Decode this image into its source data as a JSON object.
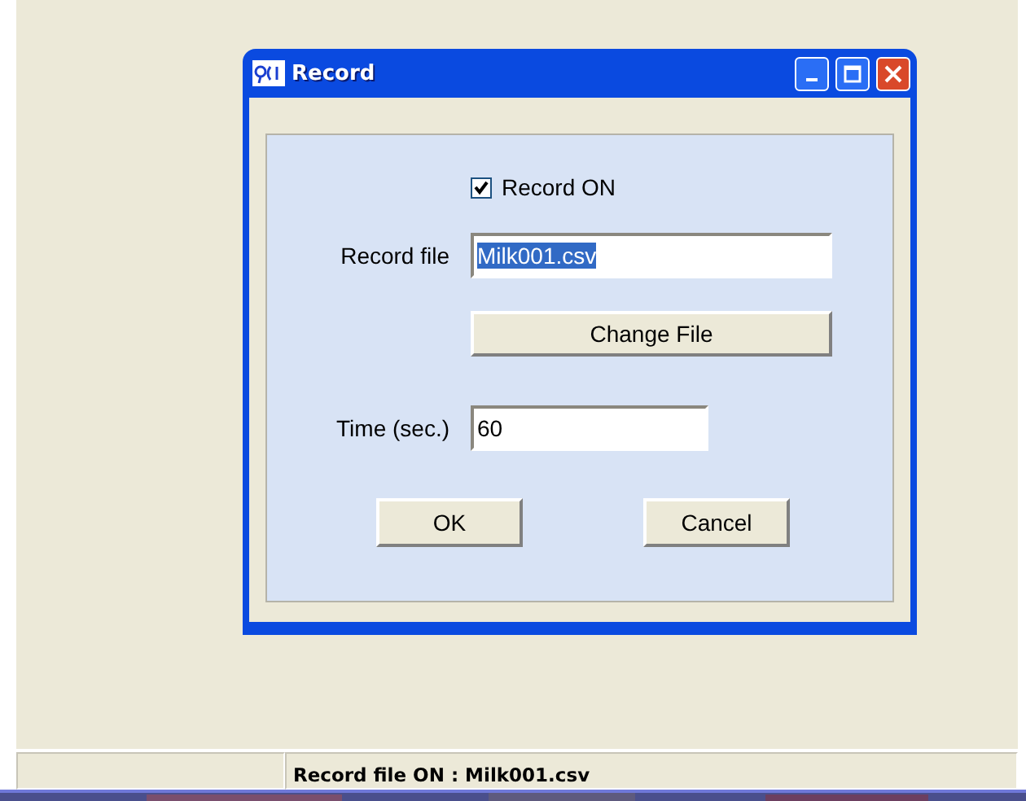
{
  "dialog": {
    "title": "Record",
    "record_on": {
      "label": "Record ON",
      "checked": true
    },
    "record_file": {
      "label": "Record file",
      "value": "Milk001.csv",
      "selected": true
    },
    "change_file_button": "Change File",
    "time": {
      "label": "Time (sec.)",
      "value": "60"
    },
    "buttons": [
      "OK",
      "Cancel"
    ]
  },
  "status_bar": {
    "text": "Record file ON : Milk001.csv"
  }
}
